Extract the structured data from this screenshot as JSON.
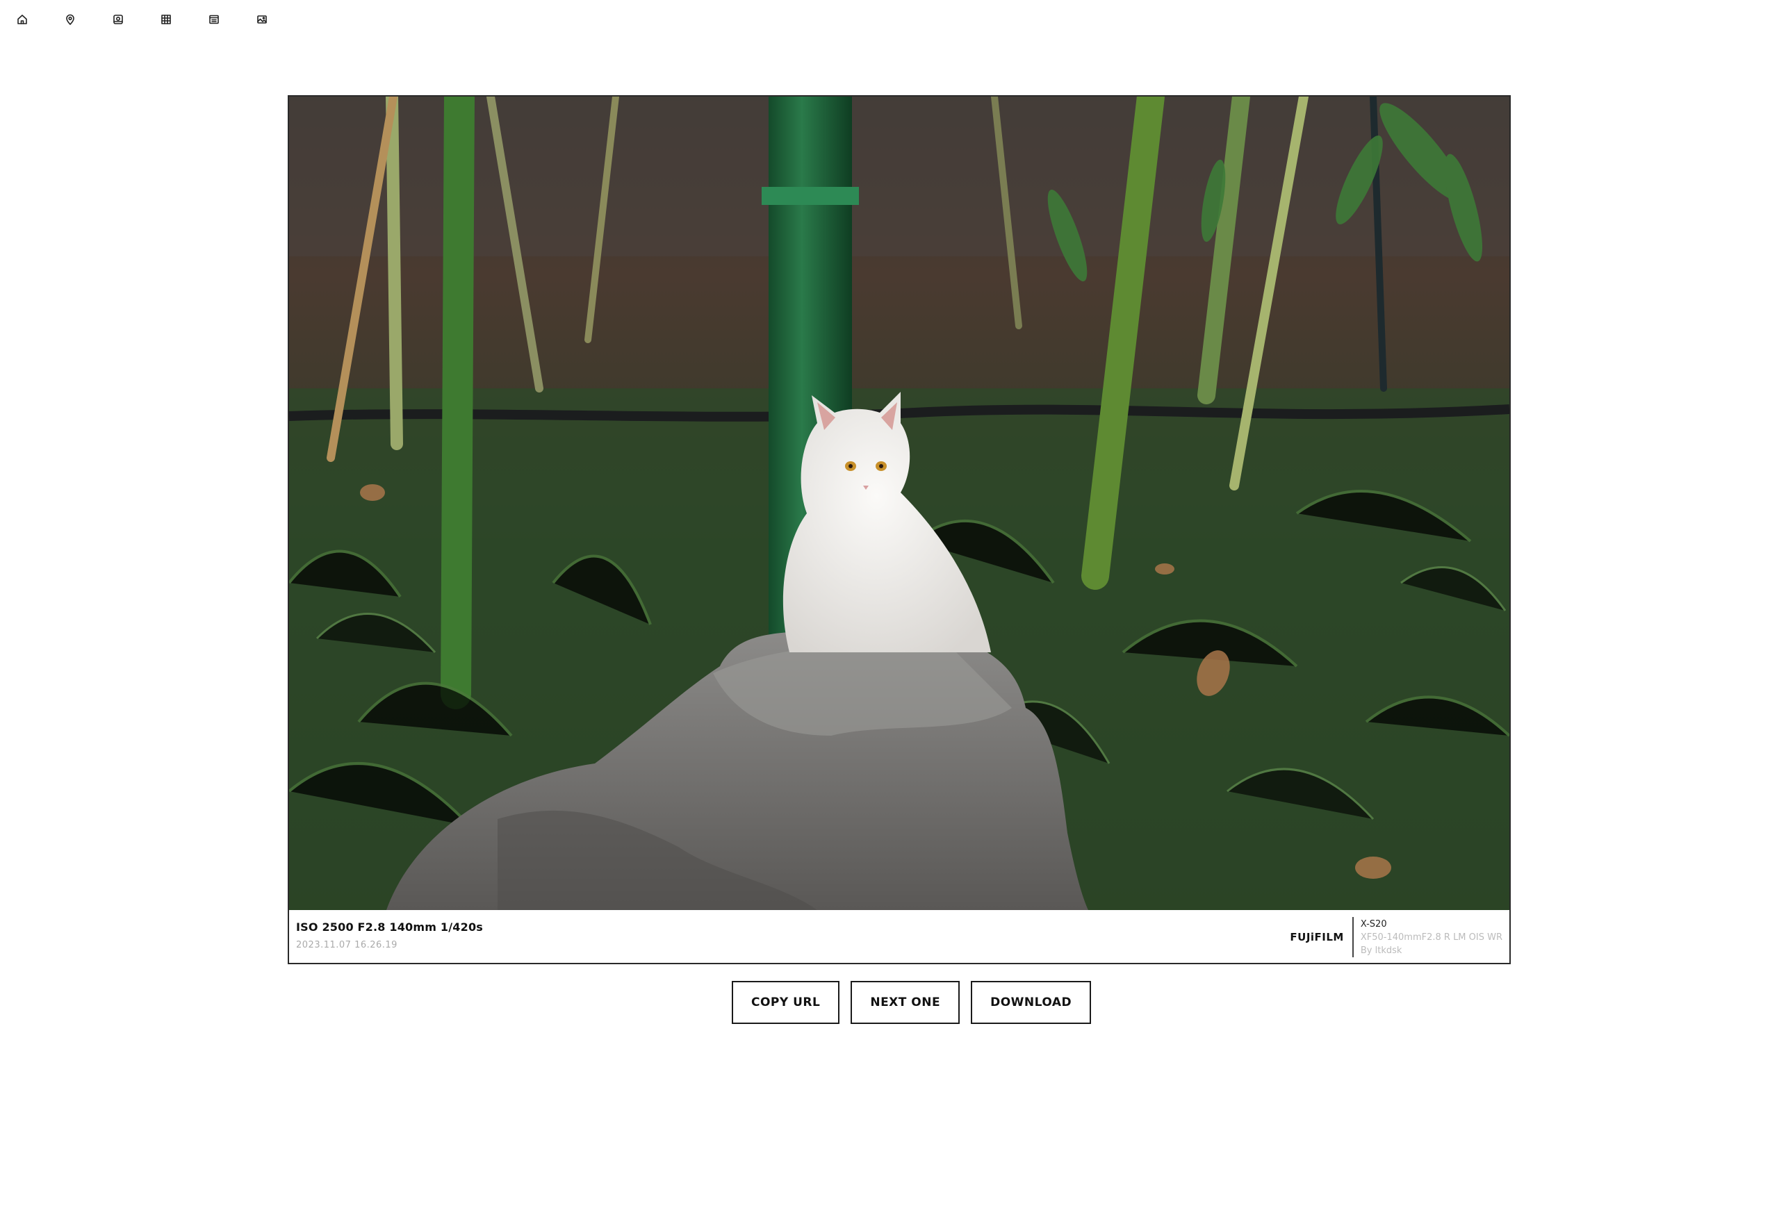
{
  "nav": {
    "items": [
      {
        "icon": "home-icon"
      },
      {
        "icon": "map-pin-icon"
      },
      {
        "icon": "camera-roll-icon"
      },
      {
        "icon": "grid-icon"
      },
      {
        "icon": "list-icon"
      },
      {
        "icon": "image-icon"
      }
    ]
  },
  "photo": {
    "subject": "white cat on rock"
  },
  "exif": {
    "params": "ISO 2500 F2.8 140mm 1/420s",
    "date": "2023.11.07 16.26.19",
    "brand": "FUJiFILM",
    "model": "X-S20",
    "lens": "XF50-140mmF2.8 R LM OIS WR",
    "author": "By ltkdsk"
  },
  "actions": {
    "copy_url": "COPY URL",
    "next_one": "NEXT ONE",
    "download": "DOWNLOAD"
  }
}
